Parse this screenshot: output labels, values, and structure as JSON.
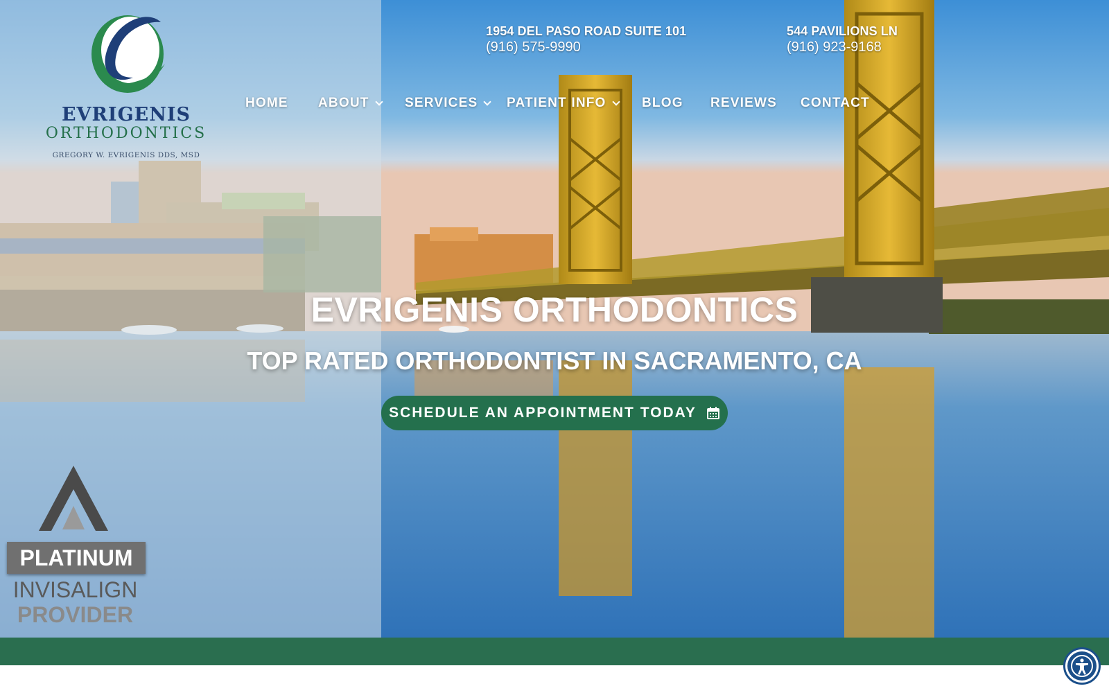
{
  "logo": {
    "brand": "EVRIGENIS",
    "brand2": "ORTHODONTICS",
    "doctor": "GREGORY W. EVRIGENIS DDS, MSD",
    "icon": "swoosh-e-logo"
  },
  "locations": [
    {
      "address": "1954 DEL PASO ROAD SUITE 101",
      "phone": "(916) 575-9990"
    },
    {
      "address": "544 PAVILIONS LN",
      "phone": "(916) 923-9168"
    }
  ],
  "nav": [
    {
      "label": "HOME",
      "dropdown": false
    },
    {
      "label": "ABOUT",
      "dropdown": true
    },
    {
      "label": "SERVICES",
      "dropdown": true
    },
    {
      "label": "PATIENT INFO",
      "dropdown": true
    },
    {
      "label": "BLOG",
      "dropdown": false
    },
    {
      "label": "REVIEWS",
      "dropdown": false
    },
    {
      "label": "CONTACT",
      "dropdown": false
    }
  ],
  "hero": {
    "title": "EVRIGENIS ORTHODONTICS",
    "subtitle": "TOP RATED ORTHODONTIST IN SACRAMENTO, CA",
    "cta_label": "SCHEDULE AN APPOINTMENT TODAY",
    "cta_icon": "calendar-icon"
  },
  "badge": {
    "line1": "PLATINUM",
    "line2": "INVISALIGN",
    "line3": "PROVIDER",
    "icon": "invisalign-a-icon"
  },
  "accessibility": {
    "icon": "accessibility-icon"
  },
  "colors": {
    "brand_green": "#24704d",
    "band_green": "#2a6e4f",
    "brand_navy": "#1f3f78",
    "accessibility_blue": "#1b4f8a"
  }
}
